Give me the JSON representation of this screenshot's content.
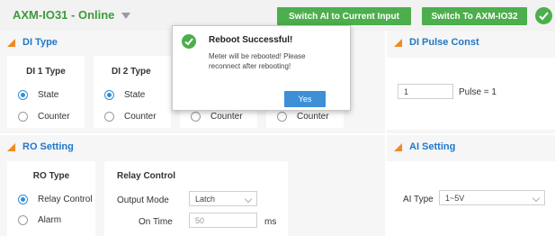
{
  "header": {
    "device_title": "AXM-IO31 - Online",
    "switch_ai_label": "Switch AI to Current Input",
    "switch_io_label": "Switch To AXM-IO32",
    "status_color": "#4cae4c"
  },
  "di_panel": {
    "title": "DI Type",
    "cards": [
      {
        "title": "DI 1 Type",
        "options": [
          "State",
          "Counter"
        ],
        "selected": "State"
      },
      {
        "title": "DI 2 Type",
        "options": [
          "State",
          "Counter"
        ],
        "selected": "State"
      },
      {
        "title": "",
        "options": [
          "",
          "Counter"
        ],
        "selected": ""
      },
      {
        "title": "",
        "options": [
          "",
          "Counter"
        ],
        "selected": ""
      }
    ]
  },
  "pulse_panel": {
    "title": "DI Pulse Const",
    "value": "1",
    "readout": "Pulse = 1"
  },
  "ro_panel": {
    "title": "RO Setting",
    "ro_type_title": "RO Type",
    "ro_options": [
      "Relay Control",
      "Alarm"
    ],
    "ro_selected": "Relay Control",
    "relay_title": "Relay Control",
    "output_mode_label": "Output Mode",
    "output_mode_value": "Latch",
    "on_time_label": "On Time",
    "on_time_value": "50",
    "on_time_unit": "ms"
  },
  "ai_panel": {
    "title": "AI Setting",
    "ai_type_label": "AI Type",
    "ai_type_value": "1~5V"
  },
  "modal": {
    "title": "Reboot Successful!",
    "message": "Meter will be rebooted! Please reconnect after rebooting!",
    "button_label": "Yes"
  },
  "colors": {
    "accent_green": "#4cae4c",
    "section_title_blue": "#1f78c8",
    "section_marker_orange": "#f08a24",
    "primary_button_blue": "#3d8fd6"
  }
}
